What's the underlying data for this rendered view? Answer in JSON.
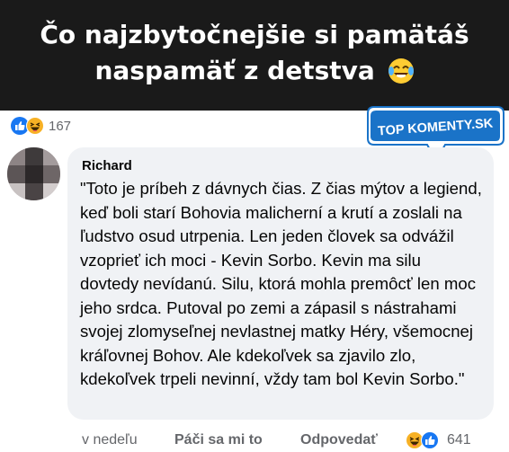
{
  "banner": {
    "line1": "Čo najzbytočnejšie si pamätáš",
    "line2": "naspamäť z detstva",
    "emoji_icon": "tears-of-joy-icon"
  },
  "top_reactions": {
    "icons": [
      "like-icon",
      "haha-icon"
    ],
    "count": "167"
  },
  "logo": {
    "text": "TOP KOMENTY.SK",
    "color": "#1a73c8"
  },
  "comment": {
    "author": "Richard",
    "text": "\"Toto je príbeh z dávnych čias. Z čias mýtov a legiend, keď boli starí Bohovia malicherní a krutí a zoslali na ľudstvo osud utrpenia. Len jeden človek sa odvážil vzoprieť ich moci - Kevin Sorbo. Kevin ma silu dovtedy nevídanú. Silu, ktorá mohla premôcť len moc jeho srdca. Putoval po zemi a zápasil s nástrahami svojej zlomyseľnej nevlastnej matky Héry, všemocnej kráľovnej Bohov. Ale kdekoľvek sa zjavilo zlo, kdekoľvek trpeli nevinní, vždy tam bol Kevin Sorbo.\""
  },
  "footer": {
    "time": "v nedeľu",
    "like_label": "Páči sa mi to",
    "reply_label": "Odpovedať",
    "reaction_icons": [
      "haha-icon",
      "like-icon"
    ],
    "count": "641"
  },
  "colors": {
    "banner_bg": "#1a1a1a",
    "bubble_bg": "#f0f2f5",
    "facebook_blue": "#1877f2",
    "muted_text": "#65676b"
  }
}
